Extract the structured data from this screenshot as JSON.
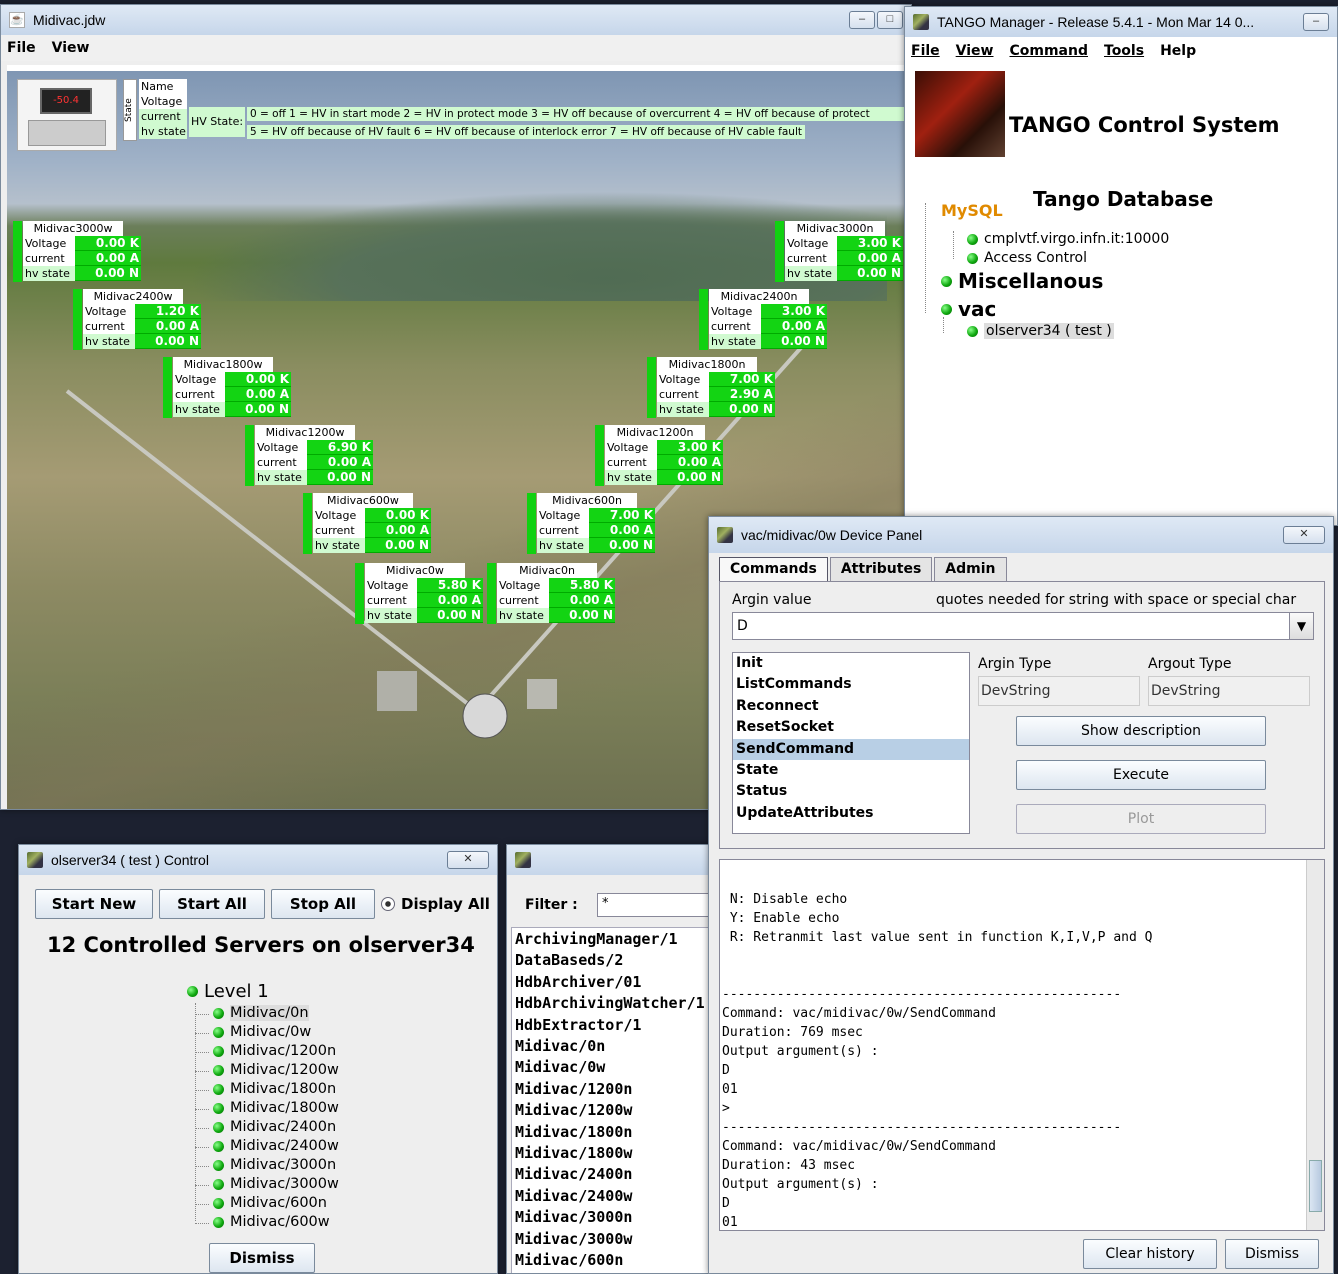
{
  "midivac": {
    "title": "Midivac.jdw",
    "menu": [
      "File",
      "View"
    ],
    "header": {
      "state_label": "State",
      "names": [
        "Name",
        "Voltage",
        "current",
        "hv state"
      ],
      "hv_state_label": "HV State:",
      "legend_line1": "0 = off  1 = HV in start mode  2 = HV in protect mode  3 = HV off because of overcurrent  4 = HV off because of protect",
      "legend_line2": "5 = HV off because of HV fault  6 = HV off because of interlock error  7 = HV off because of HV cable fault"
    },
    "row_labels": {
      "voltage": "Voltage",
      "current": "current",
      "hv_state": "hv state"
    },
    "stations": [
      {
        "name": "Midivac3000w",
        "voltage": "0.00 K",
        "current": "0.00 A",
        "hv": "0.00 N"
      },
      {
        "name": "Midivac2400w",
        "voltage": "1.20 K",
        "current": "0.00 A",
        "hv": "0.00 N"
      },
      {
        "name": "Midivac1800w",
        "voltage": "0.00 K",
        "current": "0.00 A",
        "hv": "0.00 N"
      },
      {
        "name": "Midivac1200w",
        "voltage": "6.90 K",
        "current": "0.00 A",
        "hv": "0.00 N"
      },
      {
        "name": "Midivac600w",
        "voltage": "0.00 K",
        "current": "0.00 A",
        "hv": "0.00 N"
      },
      {
        "name": "Midivac0w",
        "voltage": "5.80 K",
        "current": "0.00 A",
        "hv": "0.00 N"
      },
      {
        "name": "Midivac3000n",
        "voltage": "3.00 K",
        "current": "0.00 A",
        "hv": "0.00 N"
      },
      {
        "name": "Midivac2400n",
        "voltage": "3.00 K",
        "current": "0.00 A",
        "hv": "0.00 N"
      },
      {
        "name": "Midivac1800n",
        "voltage": "7.00 K",
        "current": "2.90 A",
        "hv": "0.00 N"
      },
      {
        "name": "Midivac1200n",
        "voltage": "3.00 K",
        "current": "0.00 A",
        "hv": "0.00 N"
      },
      {
        "name": "Midivac600n",
        "voltage": "7.00 K",
        "current": "0.00 A",
        "hv": "0.00 N"
      },
      {
        "name": "Midivac0n",
        "voltage": "5.80 K",
        "current": "0.00 A",
        "hv": "0.00 N"
      }
    ],
    "thumb_display": "-50.4"
  },
  "tango": {
    "title": "TANGO Manager - Release 5.4.1  -  Mon Mar 14 0...",
    "menu": [
      "File",
      "View",
      "Command",
      "Tools",
      "Help"
    ],
    "system_title": "TANGO Control System",
    "db_title": "Tango Database",
    "mysql_logo": "MySQL",
    "db_host": "cmplvtf.virgo.infn.it:10000",
    "access_control": "Access Control",
    "misc": "Miscellanous",
    "vac": "vac",
    "server": "olserver34  ( test )"
  },
  "device": {
    "title": "vac/midivac/0w Device Panel",
    "tabs": [
      "Commands",
      "Attributes",
      "Admin"
    ],
    "argin_label": "Argin value",
    "quotes_hint": "quotes needed for string with space or special char",
    "argin_value": "D",
    "commands": [
      "Init",
      "ListCommands",
      "Reconnect",
      "ResetSocket",
      "SendCommand",
      "State",
      "Status",
      "UpdateAttributes"
    ],
    "argin_type_label": "Argin Type",
    "argout_type_label": "Argout Type",
    "argin_type": "DevString",
    "argout_type": "DevString",
    "show_description": "Show description",
    "execute": "Execute",
    "plot": "Plot",
    "console_lines": [
      " N: Disable echo",
      " Y: Enable echo",
      " R: Retranmit last value sent in function K,I,V,P and Q",
      "",
      "",
      "---------------------------------------------------",
      "Command: vac/midivac/0w/SendCommand",
      "Duration: 769 msec",
      "Output argument(s) :",
      "D",
      "01",
      ">",
      "---------------------------------------------------",
      "Command: vac/midivac/0w/SendCommand",
      "Duration: 43 msec",
      "Output argument(s) :",
      "D",
      "01",
      ">"
    ],
    "clear_history": "Clear history",
    "dismiss": "Dismiss"
  },
  "control": {
    "title": "olserver34  ( test )  Control",
    "start_new": "Start New",
    "start_all": "Start All",
    "stop_all": "Stop All",
    "display_all": "Display All",
    "heading": "12 Controlled Servers on olserver34",
    "level": "Level 1",
    "servers": [
      "Midivac/0n",
      "Midivac/0w",
      "Midivac/1200n",
      "Midivac/1200w",
      "Midivac/1800n",
      "Midivac/1800w",
      "Midivac/2400n",
      "Midivac/2400w",
      "Midivac/3000n",
      "Midivac/3000w",
      "Midivac/600n",
      "Midivac/600w"
    ],
    "dismiss": "Dismiss"
  },
  "server_list": {
    "filter_label": "Filter :",
    "filter_value": "*",
    "items": [
      "ArchivingManager/1",
      "DataBaseds/2",
      "HdbArchiver/01",
      "HdbArchivingWatcher/1",
      "HdbExtractor/1",
      "Midivac/0n",
      "Midivac/0w",
      "Midivac/1200n",
      "Midivac/1200w",
      "Midivac/1800n",
      "Midivac/1800w",
      "Midivac/2400n",
      "Midivac/2400w",
      "Midivac/3000n",
      "Midivac/3000w",
      "Midivac/600n"
    ]
  },
  "colors": {
    "ok_green": "#13d413",
    "selection": "#b8cfe5",
    "titlebar": "#c6d6ea"
  }
}
